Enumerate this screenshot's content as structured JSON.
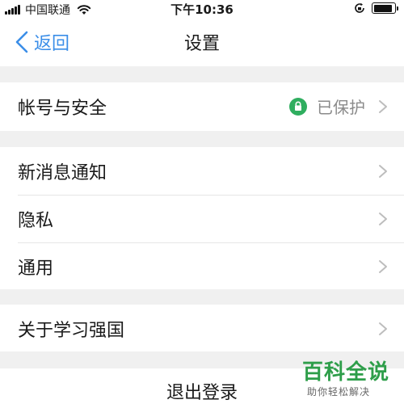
{
  "status_bar": {
    "carrier": "中国联通",
    "time": "下午10:36",
    "battery_level": 0.9
  },
  "nav": {
    "back_label": "返回",
    "title": "设置",
    "accent_color": "#3b8ee8"
  },
  "groups": {
    "account": {
      "label": "帐号与安全",
      "status": "已保护",
      "status_icon": "lock-shield-icon",
      "status_color": "#2fae5f"
    },
    "main": [
      {
        "label": "新消息通知"
      },
      {
        "label": "隐私"
      },
      {
        "label": "通用"
      }
    ],
    "about": {
      "label": "关于学习强国"
    }
  },
  "logout_label": "退出登录",
  "watermark": {
    "title": "百科全说",
    "subtitle": "助你轻松解决",
    "color": "#2e9e4a"
  }
}
